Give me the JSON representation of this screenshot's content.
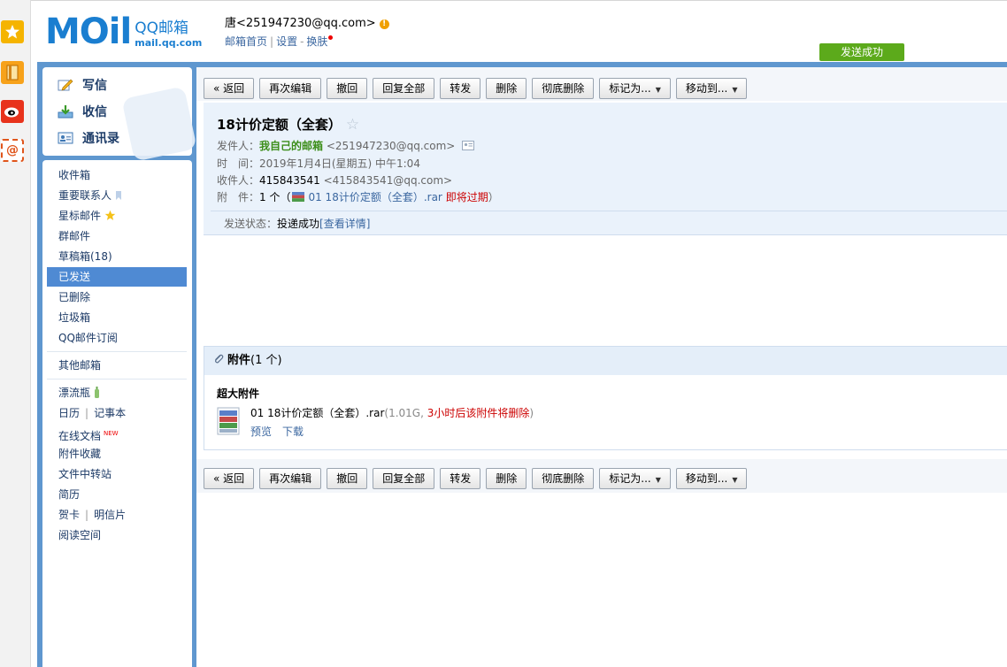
{
  "header": {
    "logo_text": "MOil",
    "logo_cn": "QQ邮箱",
    "logo_url": "mail.qq.com",
    "user": "唐<251947230@qq.com>",
    "warn_icon": "!",
    "links": [
      "邮箱首页",
      "设置",
      "换肤"
    ],
    "link_sep": "|",
    "link_dash": "-",
    "toast": "发送成功"
  },
  "sidebar_top": [
    {
      "label": "写信",
      "icon": "compose-icon"
    },
    {
      "label": "收信",
      "icon": "inbox-download-icon"
    },
    {
      "label": "通讯录",
      "icon": "contacts-icon"
    }
  ],
  "folders": {
    "inbox": "收件箱",
    "vip": "重要联系人",
    "starred": "星标邮件",
    "group": "群邮件",
    "drafts": "草稿箱(18)",
    "sent": "已发送",
    "deleted": "已删除",
    "spam": "垃圾箱",
    "subscribe": "QQ邮件订阅",
    "other": "其他邮箱",
    "bottle": "漂流瓶",
    "calendar": "日历",
    "sep": "|",
    "notes": "记事本",
    "docs": "在线文档",
    "new_badge": "NEW",
    "att_collect": "附件收藏",
    "transfer": "文件中转站",
    "resume": "简历",
    "card": "贺卡",
    "postcard": "明信片",
    "reading": "阅读空间"
  },
  "toolbar": {
    "back": "« 返回",
    "edit_again": "再次编辑",
    "recall": "撤回",
    "reply_all": "回复全部",
    "forward": "转发",
    "delete": "删除",
    "delete_perm": "彻底删除",
    "mark_as": "标记为...",
    "move_to": "移动到...",
    "arrow": "▼"
  },
  "mail": {
    "subject": "18计价定额（全套）",
    "star": "☆",
    "from_label": "发件人：",
    "from_name": "我自己的邮箱",
    "from_addr": "<251947230@qq.com>",
    "time_label": "时　间：",
    "time_value": "2019年1月4日(星期五) 中午1:04",
    "to_label": "收件人：",
    "to_name": "415843541",
    "to_addr": "<415843541@qq.com>",
    "att_label": "附　件：",
    "att_count": "1 个（",
    "att_file": "01 18计价定额（全套）.rar",
    "att_expiring": "即将过期",
    "att_close": "）",
    "status_label": "发送状态：",
    "status_value": "投递成功",
    "status_link": "[查看详情]"
  },
  "attachment": {
    "header": "附件",
    "count": "(1 个)",
    "section_title": "超大附件",
    "file": "01 18计价定额（全套）.rar",
    "size": "(1.01G, ",
    "expire": "3小时后该附件将删除",
    "size_close": ")",
    "preview": "预览",
    "download": "下载"
  }
}
